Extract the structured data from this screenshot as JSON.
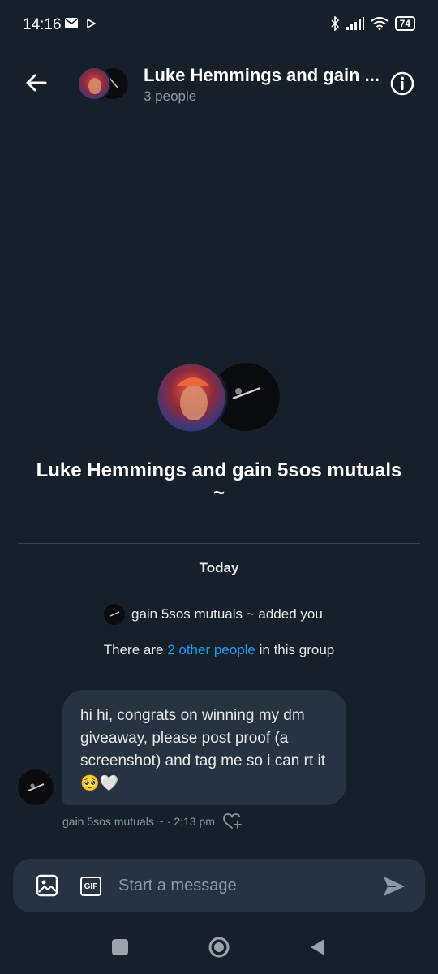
{
  "status_bar": {
    "time": "14:16",
    "battery": "74"
  },
  "header": {
    "title": "Luke Hemmings and gain ...",
    "subtitle": "3 people"
  },
  "group": {
    "name": "Luke Hemmings and gain 5sos mutuals ~"
  },
  "timeline": {
    "date_label": "Today",
    "added_text": "gain 5sos mutuals ~ added you",
    "people_prefix": "There are ",
    "people_link": "2 other people",
    "people_suffix": " in this group"
  },
  "message": {
    "text": "hi hi, congrats on winning my dm giveaway, please post proof (a screenshot) and tag me so i can rt it 🥺🤍",
    "sender": "gain 5sos mutuals ~",
    "time": "2:13 pm",
    "meta": "gain 5sos mutuals ~ · 2:13 pm"
  },
  "composer": {
    "placeholder": "Start a message",
    "gif_label": "GIF"
  },
  "colors": {
    "background": "#15202b",
    "bubble": "#273340",
    "accent": "#1d9bf0",
    "muted": "#8b98a5"
  }
}
